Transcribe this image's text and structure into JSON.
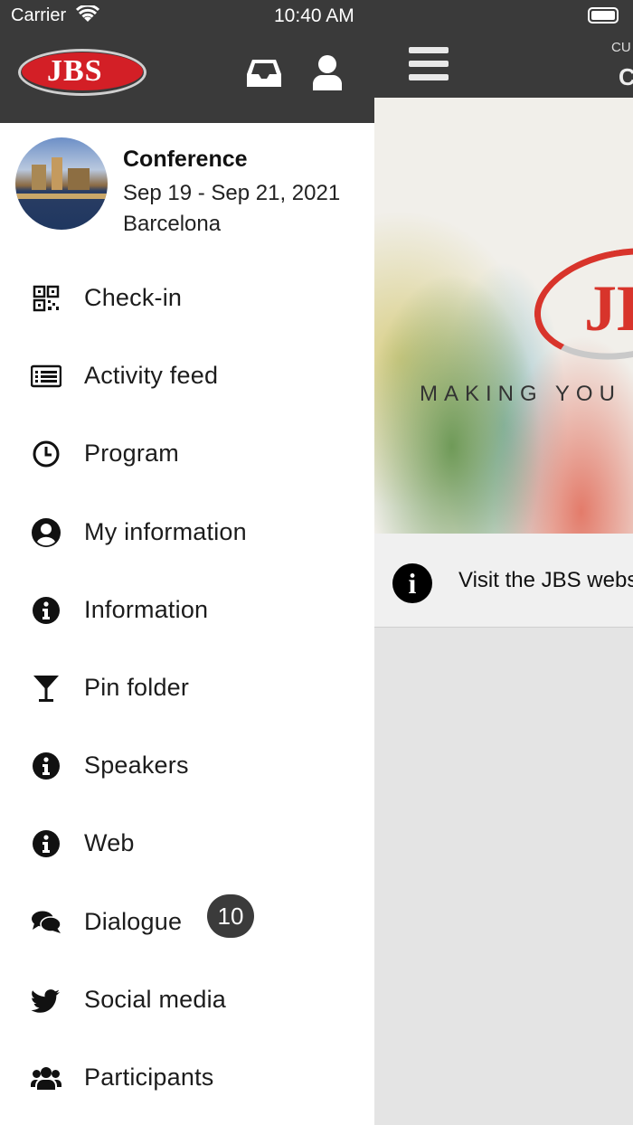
{
  "status_bar": {
    "carrier": "Carrier",
    "time": "10:40 AM"
  },
  "brand": {
    "logo_text": "JBS",
    "accent": "#d31f26",
    "header_bg": "#3a3a3a"
  },
  "header_icons": {
    "inbox": "inbox-icon",
    "profile": "user-icon"
  },
  "event": {
    "title": "Conference",
    "dates": "Sep 19 - Sep 21, 2021",
    "city": "Barcelona"
  },
  "menu": {
    "items": [
      {
        "label": "Check-in",
        "icon": "qr-code-icon"
      },
      {
        "label": "Activity feed",
        "icon": "news-icon"
      },
      {
        "label": "Program",
        "icon": "clock-icon"
      },
      {
        "label": "My information",
        "icon": "user-circle-icon"
      },
      {
        "label": "Information",
        "icon": "info-icon"
      },
      {
        "label": "Pin folder",
        "icon": "cocktail-glass-icon"
      },
      {
        "label": "Speakers",
        "icon": "info-icon"
      },
      {
        "label": "Web",
        "icon": "info-icon"
      },
      {
        "label": "Dialogue",
        "icon": "comments-icon",
        "badge": "10"
      },
      {
        "label": "Social media",
        "icon": "twitter-icon"
      },
      {
        "label": "Participants",
        "icon": "users-icon"
      }
    ]
  },
  "main": {
    "header_label_cut": "CU",
    "header_title_cut": "C",
    "hero_logo_cut": "JB",
    "hero_tagline_cut": "MAKING YOU",
    "info_row_text": "Visit the JBS webs"
  }
}
